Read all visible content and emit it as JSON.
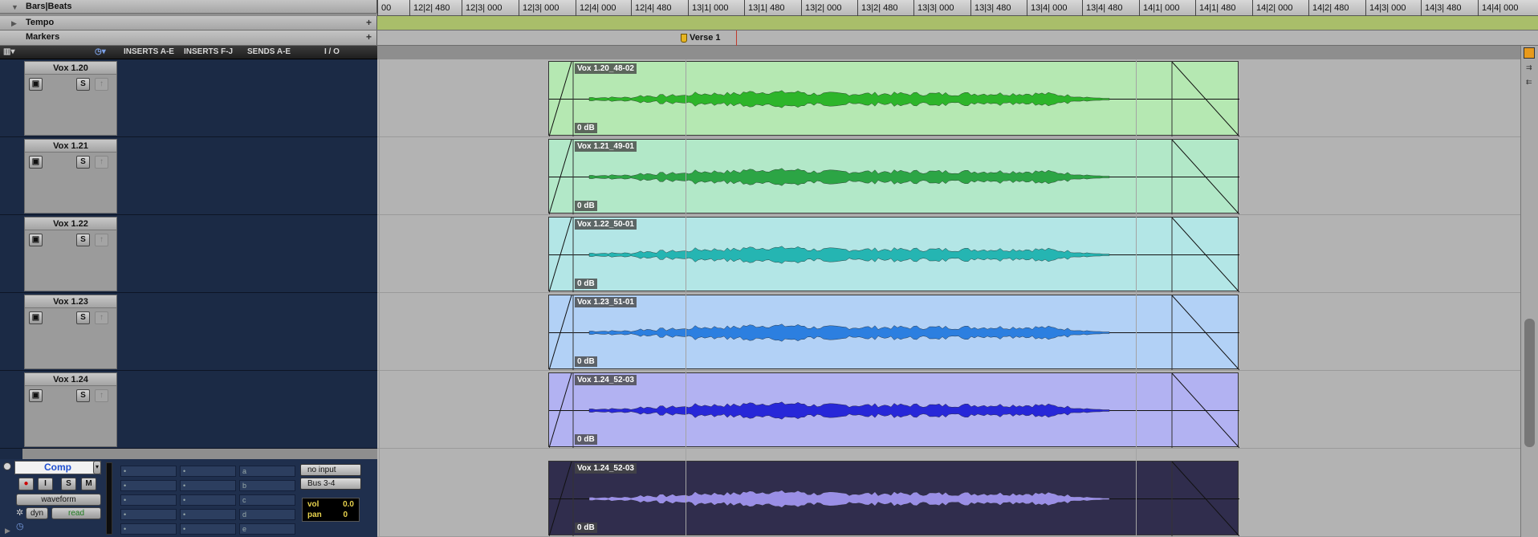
{
  "rulers": {
    "bars_label": "Bars|Beats",
    "tempo_label": "Tempo",
    "markers_label": "Markers",
    "ticks": [
      "00",
      "12|2| 480",
      "12|3| 000",
      "12|3| 000",
      "12|4| 000",
      "12|4| 480",
      "13|1| 000",
      "13|1| 480",
      "13|2| 000",
      "13|2| 480",
      "13|3| 000",
      "13|3| 480",
      "13|4| 000",
      "13|4| 480",
      "14|1| 000",
      "14|1| 480",
      "14|2| 000",
      "14|2| 480",
      "14|3| 000",
      "14|3| 480",
      "14|4| 000"
    ],
    "marker_name": "Verse 1"
  },
  "columns": {
    "inserts_ae": "INSERTS A-E",
    "inserts_fj": "INSERTS F-J",
    "sends_ae": "SENDS A-E",
    "io": "I / O"
  },
  "tracks": [
    {
      "name": "Vox 1.20",
      "clip": "Vox 1.20_48-02",
      "gain": "0 dB",
      "color": "#b5e8b2",
      "wave": "#2db52a"
    },
    {
      "name": "Vox 1.21",
      "clip": "Vox 1.21_49-01",
      "gain": "0 dB",
      "color": "#b2e8c8",
      "wave": "#2ca545"
    },
    {
      "name": "Vox 1.22",
      "clip": "Vox 1.22_50-01",
      "gain": "0 dB",
      "color": "#b3e6e6",
      "wave": "#25b5b2"
    },
    {
      "name": "Vox 1.23",
      "clip": "Vox 1.23_51-01",
      "gain": "0 dB",
      "color": "#b2d1f6",
      "wave": "#2c7fe0"
    },
    {
      "name": "Vox 1.24",
      "clip": "Vox 1.24_52-03",
      "gain": "0 dB",
      "color": "#b2b2f2",
      "wave": "#2727d8"
    }
  ],
  "track_buttons": {
    "solo": "S"
  },
  "comp": {
    "name": "Comp",
    "view_mode": "waveform",
    "dyn": "dyn",
    "automation": "read",
    "rec": "●",
    "input": "I",
    "solo": "S",
    "mute": "M",
    "sends": [
      "a",
      "b",
      "c",
      "d",
      "e"
    ],
    "inserts_placeholder": "•",
    "io_input": "no input",
    "io_output": "Bus 3-4",
    "vol_label": "vol",
    "vol_value": "0.0",
    "pan_label": "pan",
    "pan_value": "0",
    "clip": "Vox 1.24_52-03",
    "gain": "0 dB",
    "color": "#302d4d",
    "wave": "#9a8fe6"
  }
}
